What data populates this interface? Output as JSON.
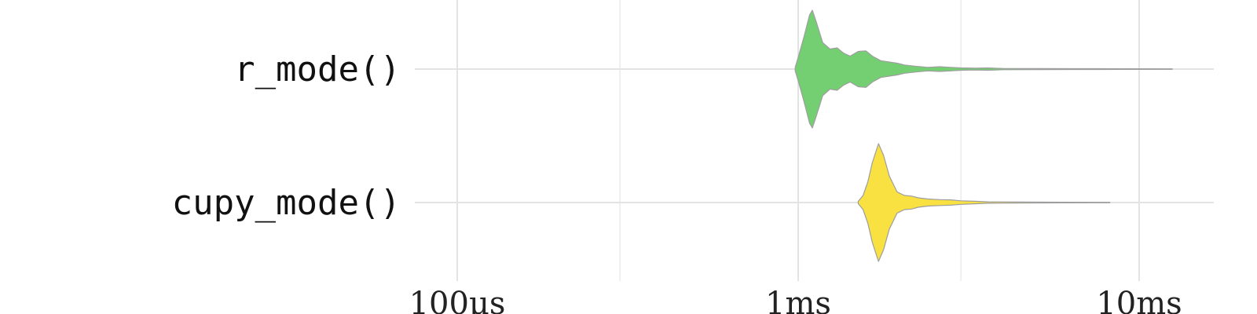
{
  "chart_data": {
    "type": "violin",
    "orientation": "horizontal",
    "x_scale": "log",
    "x_unit": "seconds",
    "xlim": [
      6e-05,
      0.016
    ],
    "x_ticks": [
      {
        "value": 0.0001,
        "label": "100µs"
      },
      {
        "value": 0.001,
        "label": "1ms"
      },
      {
        "value": 0.01,
        "label": "10ms"
      }
    ],
    "x_minor_ticks": [
      0.0003,
      0.003
    ],
    "grid": true,
    "legend": "none",
    "categories": [
      "r_mode()",
      "cupy_mode()"
    ],
    "series": [
      {
        "category": "r_mode()",
        "color": "#74CF73",
        "x_min": 0.00098,
        "x_max": 0.0125,
        "density": [
          [
            0.00098,
            0.03
          ],
          [
            0.001,
            0.2
          ],
          [
            0.00104,
            0.55
          ],
          [
            0.00108,
            0.92
          ],
          [
            0.0011,
            1.0
          ],
          [
            0.00113,
            0.8
          ],
          [
            0.00118,
            0.45
          ],
          [
            0.00124,
            0.34
          ],
          [
            0.0013,
            0.36
          ],
          [
            0.00136,
            0.27
          ],
          [
            0.00142,
            0.22
          ],
          [
            0.0015,
            0.3
          ],
          [
            0.00158,
            0.31
          ],
          [
            0.00165,
            0.22
          ],
          [
            0.00175,
            0.14
          ],
          [
            0.00185,
            0.12
          ],
          [
            0.00195,
            0.1
          ],
          [
            0.00205,
            0.07
          ],
          [
            0.0022,
            0.05
          ],
          [
            0.0024,
            0.03
          ],
          [
            0.0026,
            0.04
          ],
          [
            0.0028,
            0.03
          ],
          [
            0.003,
            0.02
          ],
          [
            0.0033,
            0.015
          ],
          [
            0.0036,
            0.02
          ],
          [
            0.004,
            0.01
          ],
          [
            0.005,
            0.008
          ],
          [
            0.007,
            0.006
          ],
          [
            0.009,
            0.005
          ],
          [
            0.0125,
            0.004
          ]
        ]
      },
      {
        "category": "cupy_mode()",
        "color": "#F9E141",
        "x_min": 0.0015,
        "x_max": 0.0082,
        "density": [
          [
            0.0015,
            0.02
          ],
          [
            0.00155,
            0.12
          ],
          [
            0.0016,
            0.35
          ],
          [
            0.00165,
            0.68
          ],
          [
            0.00172,
            1.0
          ],
          [
            0.00178,
            0.8
          ],
          [
            0.00185,
            0.45
          ],
          [
            0.00195,
            0.18
          ],
          [
            0.00205,
            0.12
          ],
          [
            0.00215,
            0.11
          ],
          [
            0.00225,
            0.08
          ],
          [
            0.0024,
            0.06
          ],
          [
            0.0026,
            0.05
          ],
          [
            0.0028,
            0.045
          ],
          [
            0.003,
            0.03
          ],
          [
            0.0033,
            0.022
          ],
          [
            0.0036,
            0.012
          ],
          [
            0.0045,
            0.008
          ],
          [
            0.006,
            0.006
          ],
          [
            0.0082,
            0.004
          ]
        ]
      }
    ]
  }
}
